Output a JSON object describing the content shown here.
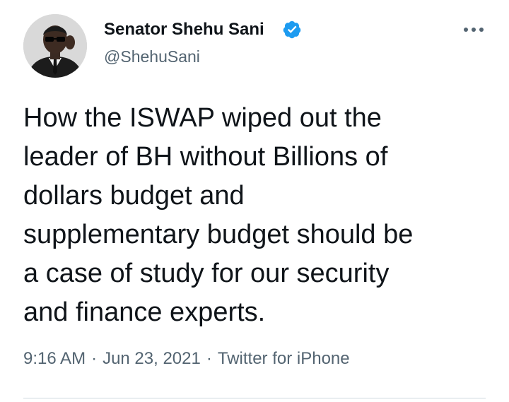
{
  "author": {
    "display_name": "Senator Shehu Sani",
    "handle": "@ShehuSani",
    "verified": true,
    "verified_icon": "verified-badge-icon",
    "verified_color": "#1d9bf0"
  },
  "tweet": {
    "lines": [
      "How the ISWAP wiped out the",
      "leader of BH without Billions of",
      "dollars budget and",
      "supplementary budget should be",
      "a case of study for our security",
      "and finance experts."
    ]
  },
  "meta": {
    "time": "9:16 AM",
    "date": "Jun 23, 2021",
    "source": "Twitter for iPhone",
    "separator": "·"
  },
  "colors": {
    "text": "#0f1419",
    "secondary": "#536471",
    "divider": "#cfd9de"
  }
}
